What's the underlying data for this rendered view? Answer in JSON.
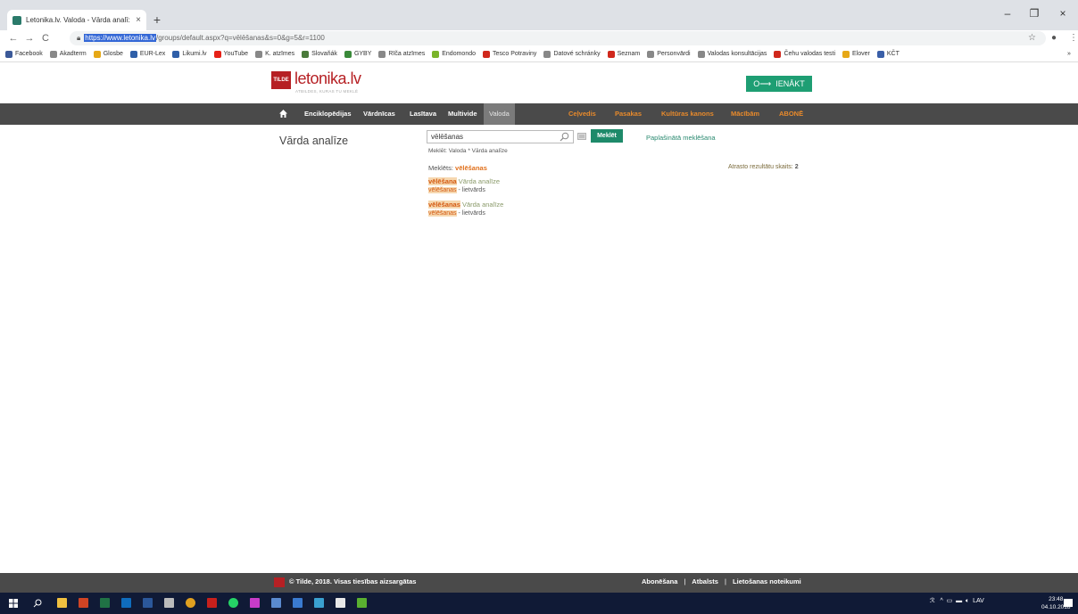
{
  "browser": {
    "tab_title": "Letonika.lv. Valoda - Vārda analī:",
    "tab_close": "×",
    "new_tab": "+",
    "url_selected": "https://www.letonika.lv",
    "url_rest": "/groups/default.aspx?q=vēlēšanas&s=0&g=5&r=1100",
    "win_minimize": "–",
    "win_maximize": "❐",
    "win_close": "×"
  },
  "bookmarks": [
    {
      "label": "Facebook",
      "color": "#3b5998"
    },
    {
      "label": "Akadterm",
      "color": "#888888"
    },
    {
      "label": "Glosbe",
      "color": "#e6a817"
    },
    {
      "label": "EUR-Lex",
      "color": "#2f5fa8"
    },
    {
      "label": "Likumi.lv",
      "color": "#2f5fa8"
    },
    {
      "label": "YouTube",
      "color": "#e62117"
    },
    {
      "label": "K. atzīmes",
      "color": "#888888"
    },
    {
      "label": "Slovaňák",
      "color": "#4a7a3a"
    },
    {
      "label": "GYBY",
      "color": "#3a8a3a"
    },
    {
      "label": "Rīča atzīmes",
      "color": "#888888"
    },
    {
      "label": "Endomondo",
      "color": "#7ab42a"
    },
    {
      "label": "Tesco Potraviny",
      "color": "#d0281c"
    },
    {
      "label": "Datové schránky",
      "color": "#888888"
    },
    {
      "label": "Seznam",
      "color": "#d0281c"
    },
    {
      "label": "Personvārdi",
      "color": "#888888"
    },
    {
      "label": "Valodas konsultācijas",
      "color": "#888888"
    },
    {
      "label": "Čehu valodas testi",
      "color": "#d0281c"
    },
    {
      "label": "Elover",
      "color": "#e6a817"
    },
    {
      "label": "KČT",
      "color": "#3a5fa8"
    }
  ],
  "bookmarks_more": "»",
  "site": {
    "logo_mark": "TILDE",
    "logo_text": "letonika.lv",
    "logo_sub": "ATBILDES, KURAS TU MEKLĒ",
    "login": "IENĀKT",
    "login_icon": "O⟶"
  },
  "nav": {
    "items": [
      "Enciklopēdijas",
      "Vārdnīcas",
      "Lasītava",
      "Multivide",
      "Valoda"
    ],
    "active": "Valoda",
    "orange_items": [
      "Ceļvedis",
      "Pasakas",
      "Kultūras kanons",
      "Mācībām",
      "ABONĒ"
    ]
  },
  "main": {
    "heading": "Vārda analīze",
    "search_value": "vēlēšanas",
    "search_button": "Meklēt",
    "advanced_search": "Paplašinātā meklēšana",
    "scope": "Meklēt: Valoda * Vārda analīze",
    "searched_label": "Meklēts:",
    "searched_term": "vēlēšanas",
    "count_label": "Atrasto rezultātu skaits:",
    "count_value": "2",
    "results": [
      {
        "term": "vēlēšana",
        "type": "Vārda analīze",
        "form": "vēlēšanas",
        "pos": "- lietvārds"
      },
      {
        "term": "vēlēšanas",
        "type": "Vārda analīze",
        "form": "vēlēšanas",
        "pos": "- lietvārds"
      }
    ]
  },
  "footer": {
    "copyright": "© Tilde, 2018. Visas tiesības aizsargātas",
    "links": [
      "Abonēšana",
      "Atbalsts",
      "Lietošanas noteikumi"
    ],
    "separator": "|"
  },
  "taskbar": {
    "tray_text": "LAV",
    "time": "23:48",
    "date": "04.10.2018"
  }
}
